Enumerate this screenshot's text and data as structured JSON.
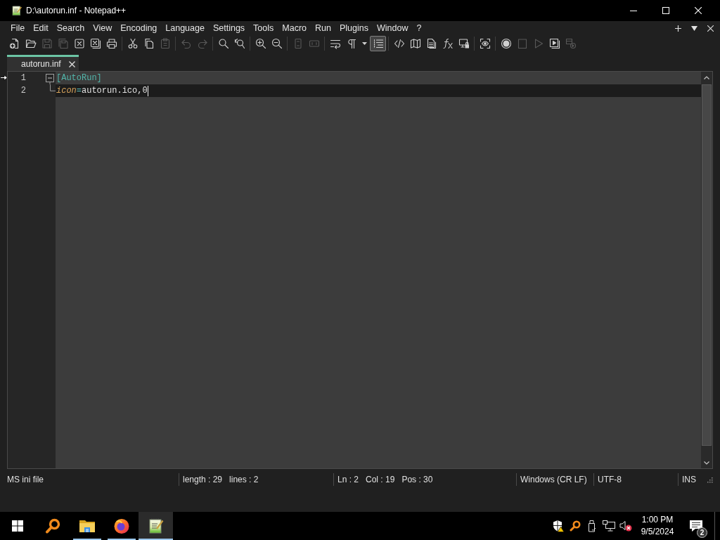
{
  "window": {
    "title": "D:\\autorun.inf - Notepad++"
  },
  "menu": [
    "File",
    "Edit",
    "Search",
    "View",
    "Encoding",
    "Language",
    "Settings",
    "Tools",
    "Macro",
    "Run",
    "Plugins",
    "Window",
    "?"
  ],
  "toolbar": [
    [
      {
        "disabled": false
      },
      {
        "disabled": false
      },
      {
        "disabled": true
      },
      {
        "disabled": true
      },
      {
        "disabled": false
      },
      {
        "disabled": false
      },
      {
        "disabled": false
      }
    ],
    [
      {
        "disabled": false
      },
      {
        "disabled": false
      },
      {
        "disabled": true
      }
    ],
    [
      {
        "disabled": true
      },
      {
        "disabled": true
      }
    ],
    [
      {
        "disabled": false
      },
      {
        "disabled": false
      }
    ],
    [
      {
        "disabled": false
      },
      {
        "disabled": false
      }
    ],
    [
      {
        "disabled": true,
        "pressed": false
      },
      {
        "disabled": true,
        "pressed": false
      }
    ],
    [
      {
        "disabled": false,
        "pressed": false
      },
      {
        "disabled": false,
        "pressed": false
      },
      {
        "disabled": false,
        "pressed": true
      }
    ],
    [
      {
        "disabled": false,
        "pressed": false
      },
      {
        "disabled": false,
        "pressed": false
      },
      {
        "disabled": false,
        "pressed": false
      },
      {
        "disabled": false,
        "pressed": false
      },
      {
        "disabled": false,
        "pressed": false
      }
    ],
    [
      {
        "disabled": false,
        "pressed": false
      }
    ],
    [
      {
        "disabled": false
      },
      {
        "disabled": true
      },
      {
        "disabled": true
      },
      {
        "disabled": false
      },
      {
        "disabled": true
      }
    ]
  ],
  "tabs": [
    {
      "label": "autorun.inf",
      "selected": true
    }
  ],
  "editor": {
    "lines": [
      {
        "number": "1",
        "fold": {
          "kind": "open"
        },
        "current": false,
        "segments": [
          {
            "kind": "section",
            "text": "[AutoRun]"
          }
        ]
      },
      {
        "number": "2",
        "fold": {
          "kind": "end"
        },
        "current": true,
        "segments": [
          {
            "kind": "key",
            "text": "icon"
          },
          {
            "kind": "assign",
            "text": "="
          },
          {
            "kind": "value",
            "text": "autorun.ico,0"
          }
        ]
      }
    ]
  },
  "status_bar": [
    [
      "MS ini file"
    ],
    [
      "length : 29",
      "lines : 2"
    ],
    [
      "Ln : 2",
      "Col : 19",
      "Pos : 30"
    ],
    [
      "Windows (CR LF)"
    ],
    [
      "UTF-8"
    ],
    [
      "INS"
    ]
  ],
  "taskbar": {
    "apps": [
      {
        "running": true,
        "selected": false
      },
      {
        "running": true,
        "selected": false
      },
      {
        "running": true,
        "selected": true
      }
    ],
    "clock": {
      "time": "1:00 PM",
      "date": "9/5/2024"
    },
    "notifications": {
      "count": "2"
    }
  }
}
